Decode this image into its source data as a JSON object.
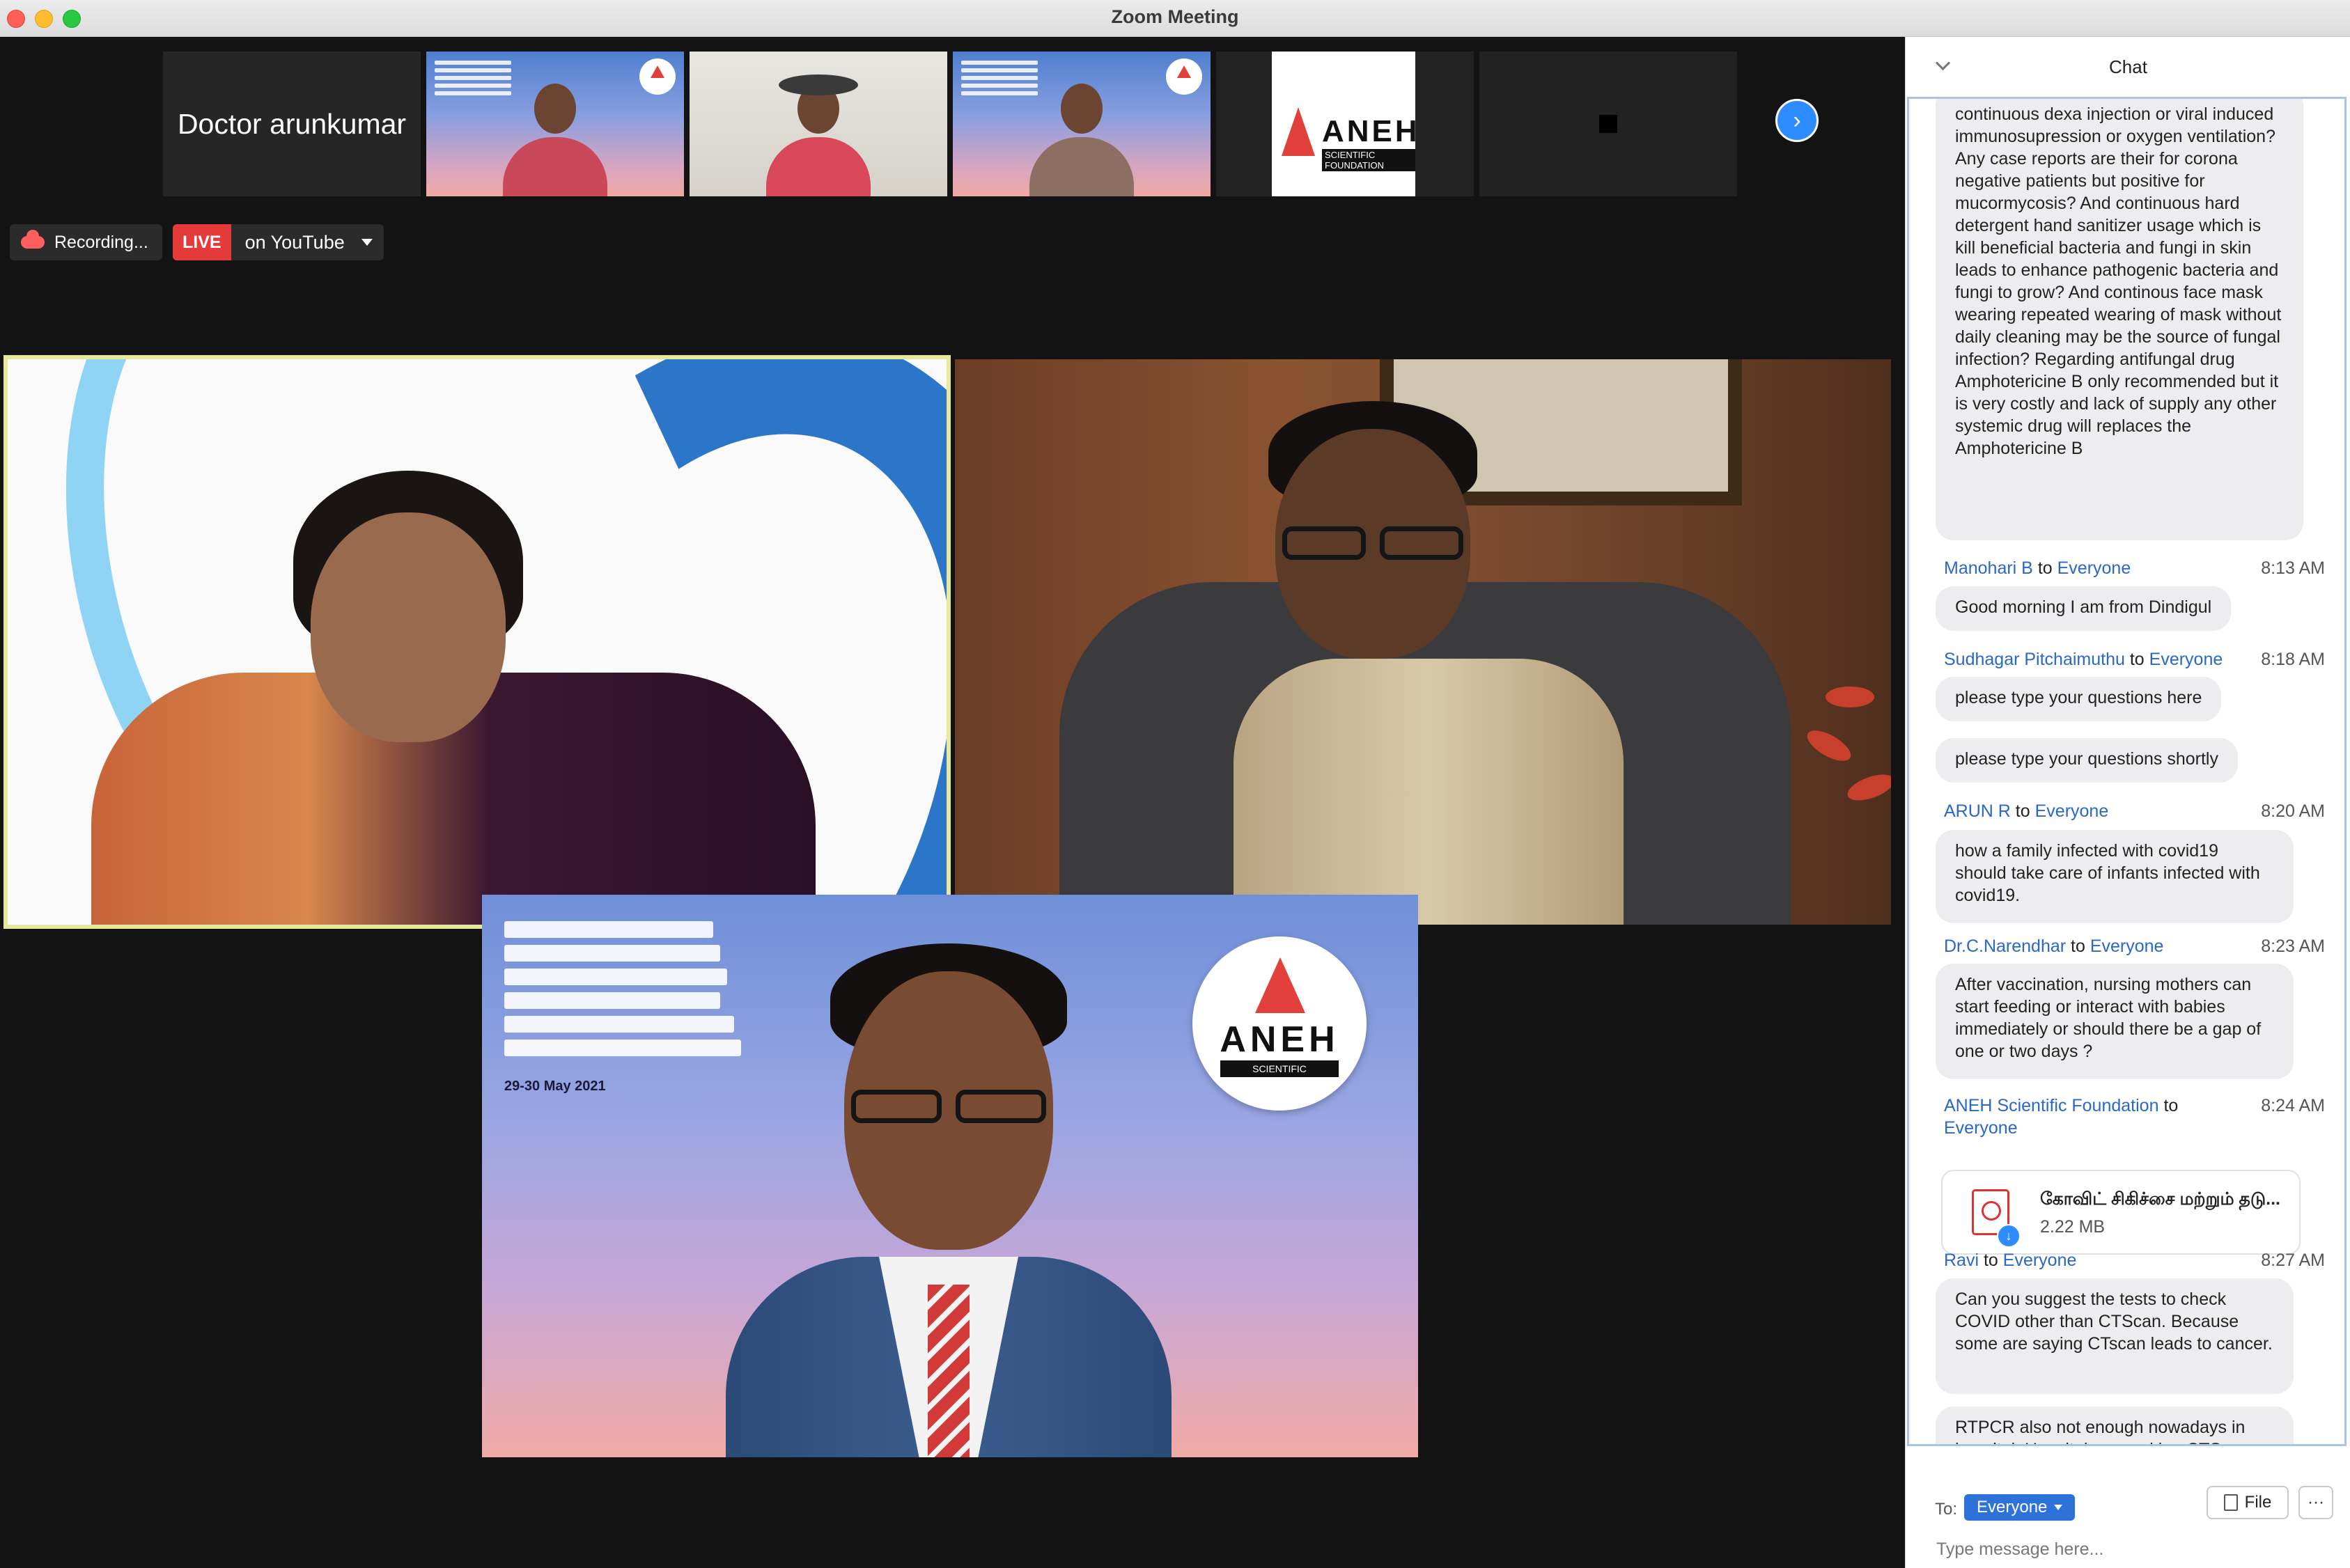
{
  "window": {
    "title": "Zoom Meeting"
  },
  "strip": {
    "name_tile": "Doctor arunkumar",
    "next_label": "›"
  },
  "status": {
    "recording": "Recording...",
    "live_badge": "LIVE",
    "live_target": "on YouTube"
  },
  "slide": {
    "date": "29-30 May 2021"
  },
  "logo": {
    "word": "ANEH",
    "sub": "SCIENTIFIC FOUNDATION"
  },
  "chat": {
    "title": "Chat",
    "first_message": "continuous dexa injection or viral induced immunosupression or oxygen ventilation? Any case reports are their for corona negative patients but positive for mucormycosis? And continuous hard detergent hand sanitizer usage which is kill beneficial bacteria and fungi in skin leads to enhance pathogenic bacteria and fungi to grow? And continous face mask wearing repeated wearing of mask without daily cleaning may be the source of fungal infection? Regarding antifungal drug Amphotericine B only recommended but it is very costly and lack of supply any other systemic drug will replaces the Amphotericine B",
    "to_word": "to",
    "messages": [
      {
        "sender": "Manohari B",
        "recipient": "Everyone",
        "time": "8:13 AM",
        "texts": [
          "Good morning I am from Dindigul"
        ]
      },
      {
        "sender": "Sudhagar Pitchaimuthu",
        "recipient": "Everyone",
        "time": "8:18 AM",
        "texts": [
          "please type your questions here",
          "please type your questions shortly"
        ]
      },
      {
        "sender": "ARUN R",
        "recipient": "Everyone",
        "time": "8:20 AM",
        "texts": [
          "how a family infected with covid19 should take care of infants infected with covid19."
        ]
      },
      {
        "sender": "Dr.C.Narendhar",
        "recipient": "Everyone",
        "time": "8:23 AM",
        "texts": [
          "After vaccination, nursing mothers can start feeding or interact with babies immediately or should there be a gap of one or two days ?"
        ]
      },
      {
        "sender": "ANEH Scientific Foundation",
        "recipient": "Everyone",
        "time": "8:24 AM",
        "file": {
          "name": "கோவிட் சிகிச்சை மற்றும் தடு...",
          "size": "2.22 MB"
        }
      },
      {
        "sender": "Ravi",
        "recipient": "Everyone",
        "time": "8:27 AM",
        "texts": [
          "Can you suggest the tests to check COVID other than CTScan. Because some are saying CTscan leads to cancer.",
          "RTPCR also not enough nowadays in hospital. Hospitals are asking CTScan"
        ]
      }
    ],
    "footer": {
      "to_label": "To:",
      "recipient": "Everyone",
      "file_button": "File",
      "more_button": "···",
      "placeholder": "Type message here..."
    }
  }
}
